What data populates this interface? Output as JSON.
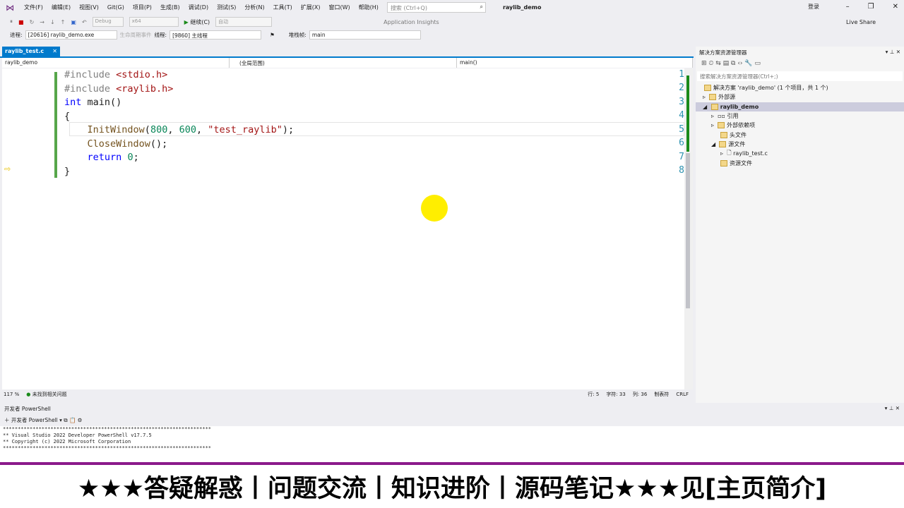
{
  "menu": {
    "items": [
      "文件(F)",
      "编辑(E)",
      "视图(V)",
      "Git(G)",
      "项目(P)",
      "生成(B)",
      "调试(D)",
      "测试(S)",
      "分析(N)",
      "工具(T)",
      "扩展(X)",
      "窗口(W)",
      "帮助(H)"
    ],
    "search_placeholder": "搜索 (Ctrl+Q)",
    "title": "raylib_demo",
    "login": "登录"
  },
  "toolbar": {
    "config": "Debug",
    "platform": "x64",
    "continue": "继续(C)",
    "auto": "自动",
    "insights": "Application Insights",
    "live_share": "Live Share"
  },
  "debugbar": {
    "process_label": "进程:",
    "process": "[20616] raylib_demo.exe",
    "lifecycle": "生命周期事件",
    "thread_label": "线程:",
    "thread": "[9860] 主线程",
    "stack_label": "堆栈帧:",
    "stack": "main"
  },
  "tab": {
    "label": "raylib_test.c"
  },
  "nav": {
    "project": "raylib_demo",
    "scope": "(全局范围)",
    "func": "main()"
  },
  "code": {
    "lines": [
      "1",
      "2",
      "3",
      "4",
      "5",
      "6",
      "7",
      "8"
    ]
  },
  "status": {
    "zoom": "117 %",
    "issues": "未找到相关问题",
    "line": "行: 5",
    "char": "字符: 33",
    "col": "列: 36",
    "tabs": "制表符",
    "eol": "CRLF"
  },
  "solution": {
    "title": "解决方案资源管理器",
    "search": "搜索解决方案资源管理器(Ctrl+;)",
    "items": [
      "解决方案 'raylib_demo' (1 个项目，共 1 个)",
      "外部源",
      "raylib_demo",
      "引用",
      "外部依赖项",
      "头文件",
      "源文件",
      "raylib_test.c",
      "资源文件"
    ]
  },
  "powershell": {
    "title": "开发者 PowerShell",
    "tab": "开发者 PowerShell",
    "lines": [
      "**********************************************************************",
      "** Visual Studio 2022 Developer PowerShell v17.7.5",
      "** Copyright (c) 2022 Microsoft Corporation",
      "**********************************************************************"
    ]
  },
  "banner": {
    "text": "★★★答疑解惑丨问题交流丨知识进阶丨源码笔记★★★见[主页简介]"
  }
}
